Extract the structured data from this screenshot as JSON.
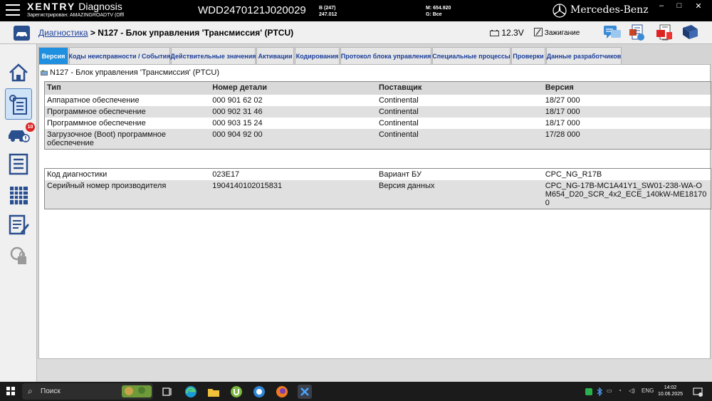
{
  "titlebar": {
    "brand": "XENTRY",
    "product": "Diagnosis",
    "registered": "Зарегистрирован: AMAZINGROADTV (Offl",
    "vin": "WDD2470121J020029",
    "b_line1": "B (247)",
    "b_line2": "247.012",
    "m_line1": "M: 654.920",
    "m_line2": "G: Все",
    "mb_text": "Mercedes-Benz",
    "minimize": "–",
    "maximize": "□",
    "close": "✕"
  },
  "navbar": {
    "breadcrumb_link": "Диагностика",
    "breadcrumb_sep": " > ",
    "breadcrumb_current": "N127 - Блок управления 'Трансмиссия' (PTCU)",
    "battery": "12.3V",
    "ignition": "Зажигание"
  },
  "sidebar": {
    "badge_count": "10"
  },
  "tabs": [
    "Версия",
    "Коды неисправности / События",
    "Действительные значения",
    "Активации",
    "Кодирования",
    "Протокол блока управления",
    "Специальные процессы",
    "Проверки",
    "Данные разработчиков"
  ],
  "ecu_title": "N127 - Блок управления 'Трансмиссия' (PTCU)",
  "version_table": {
    "headers": [
      "Тип",
      "Номер детали",
      "Поставщик",
      "Версия"
    ],
    "rows": [
      [
        "Аппаратное обеспечение",
        "000 901 62 02",
        "Continental",
        "18/27 000"
      ],
      [
        "Программное обеспечение",
        "000 902 31 46",
        "Continental",
        "18/17 000"
      ],
      [
        "Программное обеспечение",
        "000 903 15 24",
        "Continental",
        "18/17 000"
      ],
      [
        "Загрузочное (Boot) программное обеспечение",
        "000 904 92 00",
        "Continental",
        "17/28 000"
      ]
    ]
  },
  "info_table": {
    "rows": [
      [
        "Код диагностики",
        "023E17",
        "Вариант БУ",
        "CPC_NG_R17B"
      ],
      [
        "Серийный номер производителя",
        "1904140102015831",
        "Версия данных",
        "CPC_NG-17B-MC1A41Y1_SW01-238-WA-OM654_D20_SCR_4x2_ECE_140kW-ME181700"
      ]
    ]
  },
  "taskbar": {
    "search": "Поиск",
    "lang": "ENG",
    "time": "14:02",
    "date": "10.06.2025"
  },
  "colors": {
    "active_tab": "#1f8fe0",
    "link": "#1a3e9a",
    "badge": "#dd2222"
  }
}
